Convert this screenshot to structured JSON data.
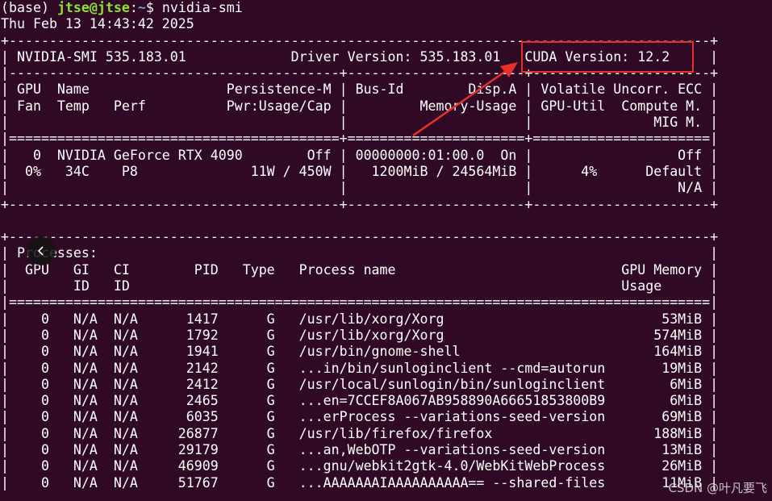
{
  "terminal": {
    "prompt_env": "(base) ",
    "prompt_user": "jtse@jtse",
    "prompt_sep": ":",
    "prompt_path": "~",
    "prompt_dollar": "$ ",
    "command": "nvidia-smi",
    "lines": [
      "Thu Feb 13 14:43:42 2025",
      "+---------------------------------------------------------------------------------------+",
      "| NVIDIA-SMI 535.183.01             Driver Version: 535.183.01   CUDA Version: 12.2     |",
      "|-----------------------------------------+----------------------+----------------------+",
      "| GPU  Name                 Persistence-M | Bus-Id        Disp.A | Volatile Uncorr. ECC |",
      "| Fan  Temp   Perf          Pwr:Usage/Cap |         Memory-Usage | GPU-Util  Compute M. |",
      "|                                         |                      |               MIG M. |",
      "|=========================================+======================+======================|",
      "|   0  NVIDIA GeForce RTX 4090        Off | 00000000:01:00.0  On |                  Off |",
      "|  0%   34C    P8              11W / 450W |   1200MiB / 24564MiB |      4%      Default |",
      "|                                         |                      |                  N/A |",
      "+-----------------------------------------+----------------------+----------------------+",
      "",
      "+---------------------------------------------------------------------------------------+",
      "| Processes:                                                                            |",
      "|  GPU   GI   CI        PID   Type   Process name                            GPU Memory |",
      "|        ID   ID                                                             Usage      |",
      "|=======================================================================================|",
      "|    0   N/A  N/A      1417      G   /usr/lib/xorg/Xorg                           53MiB |",
      "|    0   N/A  N/A      1792      G   /usr/lib/xorg/Xorg                          574MiB |",
      "|    0   N/A  N/A      1941      G   /usr/bin/gnome-shell                        164MiB |",
      "|    0   N/A  N/A      2142      G   ...in/bin/sunloginclient --cmd=autorun       19MiB |",
      "|    0   N/A  N/A      2412      G   /usr/local/sunlogin/bin/sunloginclient        6MiB |",
      "|    0   N/A  N/A      2465      G   ...en=7CCEF8A067AB958890A66651853800B9        6MiB |",
      "|    0   N/A  N/A      6035      G   ...erProcess --variations-seed-version       69MiB |",
      "|    0   N/A  N/A     26877      G   /usr/lib/firefox/firefox                    188MiB |",
      "|    0   N/A  N/A     29179      G   ...an,WebOTP --variations-seed-version       13MiB |",
      "|    0   N/A  N/A     46909      G   ...gnu/webkit2gtk-4.0/WebKitWebProcess       26MiB |",
      "|    0   N/A  N/A     51767      G   ...AAAAAAAIAAAAAAAAAA== --shared-files       11MiB |"
    ]
  },
  "overlay": {
    "back_icon": "chevron-left-icon",
    "highlight_color": "#e8302b",
    "watermark": "CSDN @叶凡要飞"
  }
}
